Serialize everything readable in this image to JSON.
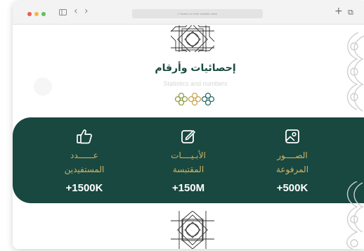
{
  "browser": {
    "address_placeholder": "Search or enter website name",
    "nav_back": "‹",
    "nav_forward": "›",
    "new_tab": "+",
    "tabs_overview": "⧉"
  },
  "section": {
    "title_ar": "إحصائيات وأرقام",
    "title_en": "Statistics and numbers"
  },
  "stats": [
    {
      "icon": "photo-icon",
      "label_line1": "الصــــور",
      "label_line2": "المرفوعة",
      "value": "+500K"
    },
    {
      "icon": "edit-icon",
      "label_line1": "الأبـيــــات",
      "label_line2": "المقتبسة",
      "value": "+150M"
    },
    {
      "icon": "thumbs-up-icon",
      "label_line1": "عــــــدد",
      "label_line2": "المستفيدين",
      "value": "+1500K"
    }
  ],
  "colors": {
    "band": "#184840",
    "gold": "#d4b264",
    "title": "#194a40",
    "ornament_olive": "#8f9c45",
    "ornament_gold": "#c8a551",
    "ornament_teal": "#2a6e6b"
  }
}
